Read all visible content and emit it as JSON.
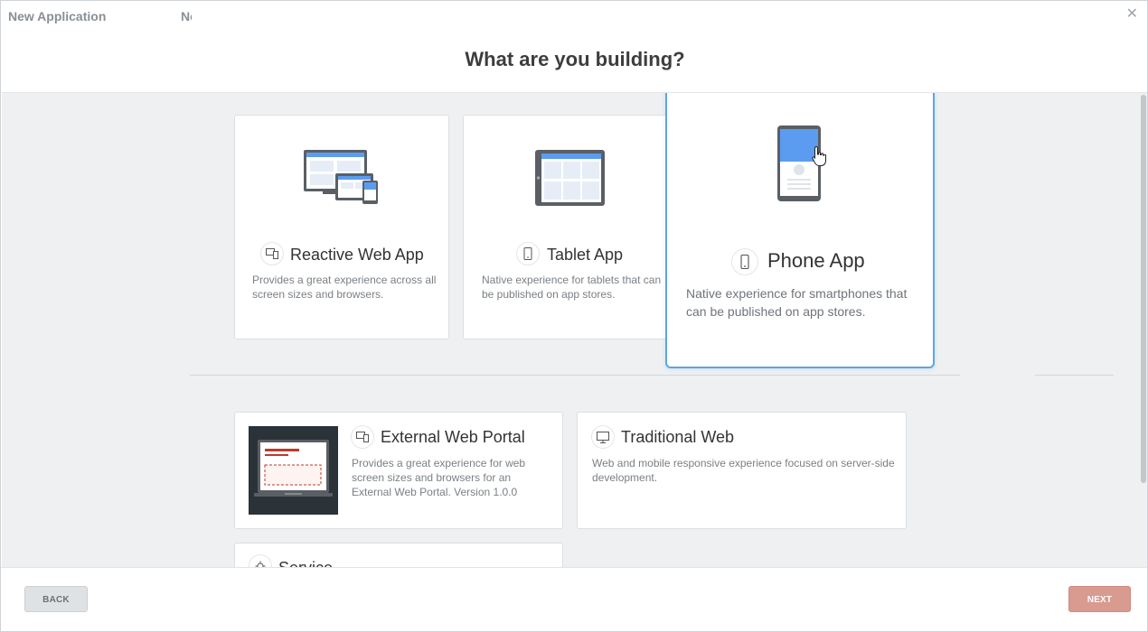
{
  "window": {
    "title": "New Application",
    "tab_stub": "Ne",
    "close_glyph": "✕"
  },
  "heading": "What are you building?",
  "cards": {
    "reactive": {
      "title": "Reactive Web App",
      "desc": "Provides a great experience across all screen sizes and browsers.",
      "icon": "devices-icon"
    },
    "tablet": {
      "title": "Tablet App",
      "desc": "Native experience for tablets that can be published on app stores.",
      "icon": "tablet-icon"
    },
    "phone": {
      "title": "Phone App",
      "desc": "Native experience for smartphones that can be published on app stores.",
      "icon": "phone-icon",
      "selected": true
    },
    "external_portal": {
      "title": "External Web Portal",
      "desc": "Provides a great experience for web screen sizes and browsers for an External Web Portal. Version 1.0.0",
      "icon": "devices-icon"
    },
    "traditional": {
      "title": "Traditional Web",
      "desc": "Web and mobile responsive experience focused on server-side development.",
      "icon": "monitor-icon"
    },
    "service": {
      "title": "Service",
      "icon": "service-icon"
    }
  },
  "footer": {
    "back_label": "BACK",
    "next_label": "NEXT"
  },
  "colors": {
    "selected_border": "#5aa6e6",
    "next_button": "#d99a90",
    "content_bg": "#eef0f2",
    "accent_blue": "#5b9cf0",
    "portal_red": "#c0392b"
  }
}
